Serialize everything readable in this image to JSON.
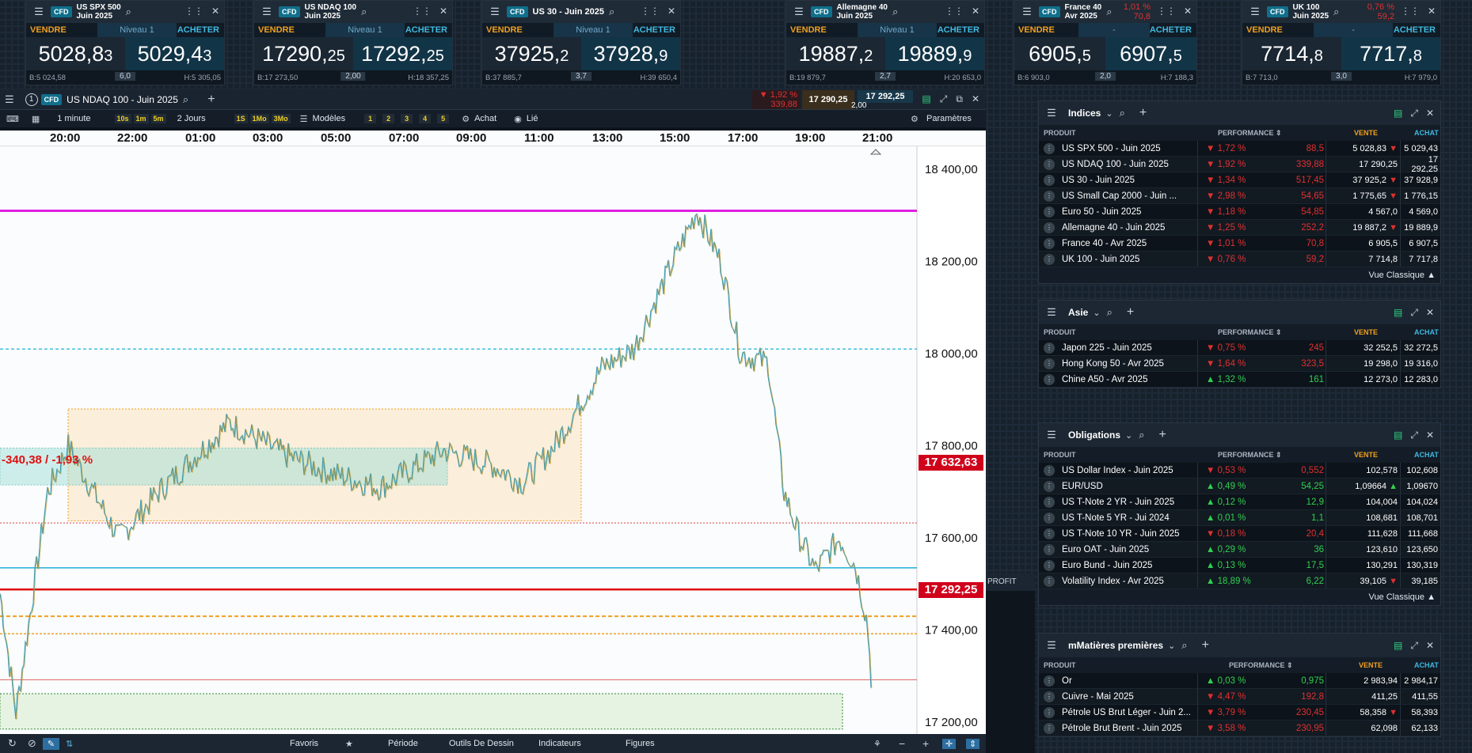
{
  "tiles": [
    {
      "name": "US SPX 500",
      "sub": "Juin 2025",
      "bid_main": "5028,8",
      "bid_small": "3",
      "ask_main": "5029,4",
      "ask_small": "3",
      "low": "B:5 024,58",
      "spread": "6,0",
      "high": "H:5 305,05",
      "level": "Niveau 1",
      "sell": "VENDRE",
      "buy": "ACHETER"
    },
    {
      "name": "US NDAQ 100",
      "sub": "Juin 2025",
      "bid_main": "17290,",
      "bid_small": "25",
      "ask_main": "17292,",
      "ask_small": "25",
      "low": "B:17 273,50",
      "spread": "2,00",
      "high": "H:18 357,25",
      "level": "Niveau 1",
      "sell": "VENDRE",
      "buy": "ACHETER"
    },
    {
      "name": "US 30 - Juin 2025",
      "sub": "",
      "bid_main": "37925,",
      "bid_small": "2",
      "ask_main": "37928,",
      "ask_small": "9",
      "low": "B:37 885,7",
      "spread": "3,7",
      "high": "H:39 650,4",
      "level": "Niveau 1",
      "sell": "VENDRE",
      "buy": "ACHETER"
    },
    {
      "name": "Allemagne 40",
      "sub": "Juin 2025",
      "bid_main": "19887,",
      "bid_small": "2",
      "ask_main": "19889,",
      "ask_small": "9",
      "low": "B:19 879,7",
      "spread": "2,7",
      "high": "H:20 653,0",
      "level": "Niveau 1",
      "sell": "VENDRE",
      "buy": "ACHETER"
    },
    {
      "name": "France 40",
      "sub": "Avr 2025",
      "pct": "1,01 %",
      "chg": "70,8",
      "bid_main": "6905,",
      "bid_small": "5",
      "ask_main": "6907,",
      "ask_small": "5",
      "low": "B:6 903,0",
      "spread": "2,0",
      "high": "H:7 188,3",
      "level": "-",
      "sell": "VENDRE",
      "buy": "ACHETER"
    },
    {
      "name": "UK 100",
      "sub": "Juin 2025",
      "pct": "0,76 %",
      "chg": "59,2",
      "bid_main": "7714,",
      "bid_small": "8",
      "ask_main": "7717,",
      "ask_small": "8",
      "low": "B:7 713,0",
      "spread": "3,0",
      "high": "H:7 979,0",
      "level": "-",
      "sell": "VENDRE",
      "buy": "ACHETER"
    }
  ],
  "chart": {
    "window_num": "1",
    "title": "US NDAQ 100 - Juin 2025",
    "pct": "1,92 %",
    "chg": "339,88",
    "bid": "17 290,25",
    "ask": "17 292,25",
    "spread": "2,00",
    "toolbar": {
      "interval": "1 minute",
      "i10s": "10s",
      "i1m": "1m",
      "i5m": "5m",
      "range": "2 Jours",
      "r1s": "1S",
      "r1mo": "1Mo",
      "r3mo": "3Mo",
      "models": "Modèles",
      "n1": "1",
      "n2": "2",
      "n3": "3",
      "n4": "4",
      "n5": "5",
      "buy": "Achat",
      "linked": "Lié",
      "settings": "Paramètres"
    },
    "x_ticks": [
      "20:00",
      "22:00",
      "01:00",
      "03:00",
      "05:00",
      "07:00",
      "09:00",
      "11:00",
      "13:00",
      "15:00",
      "17:00",
      "19:00",
      "21:00"
    ],
    "y_ticks": [
      "18 400,00",
      "18 200,00",
      "18 000,00",
      "17 800,00",
      "17 600,00",
      "17 400,00",
      "17 200,00"
    ],
    "tag_ref": "17 632,63",
    "tag_last": "17 292,25",
    "change_label": "-340,38 / -1,93 %",
    "profit_label": "PROFIT",
    "bottom": {
      "fav": "Favoris",
      "period": "Période",
      "draw": "Outils De Dessin",
      "ind": "Indicateurs",
      "fig": "Figures"
    }
  },
  "chart_data": {
    "type": "line",
    "title": "US NDAQ 100 - Juin 2025",
    "x": [
      "20:00",
      "22:00",
      "01:00",
      "03:00",
      "05:00",
      "07:00",
      "09:00",
      "11:00",
      "13:00",
      "15:00",
      "17:00",
      "19:00",
      "21:00"
    ],
    "y": [
      17400,
      17700,
      17770,
      17800,
      17790,
      17720,
      17790,
      17740,
      17950,
      18340,
      17970,
      17510,
      17292
    ],
    "ylim": [
      17140,
      18450
    ],
    "horizontal_lines": [
      18310,
      18010,
      17632.63,
      17535,
      17488,
      17430,
      17392,
      17292.25
    ]
  },
  "panels": [
    {
      "title": "Indices",
      "cols": [
        "PRODUIT",
        "PERFORMANCE",
        "VENTE",
        "ACHAT"
      ],
      "footer": "Vue Classique",
      "rows": [
        {
          "name": "US SPX 500 - Juin 2025",
          "pct": "1,72 %",
          "dir": "dn",
          "chg": "88,5",
          "bid": "5 028,83",
          "ask": "5 029,43",
          "arr": "▼"
        },
        {
          "name": "US NDAQ 100 - Juin 2025",
          "pct": "1,92 %",
          "dir": "dn",
          "chg": "339,88",
          "bid": "17 290,25",
          "ask": "17 292,25",
          "arr": ""
        },
        {
          "name": "US 30 - Juin 2025",
          "pct": "1,34 %",
          "dir": "dn",
          "chg": "517,45",
          "bid": "37 925,2",
          "ask": "37 928,9",
          "arr": "▼"
        },
        {
          "name": "US Small Cap 2000 - Juin ...",
          "pct": "2,98 %",
          "dir": "dn",
          "chg": "54,65",
          "bid": "1 775,65",
          "ask": "1 776,15",
          "arr": "▼"
        },
        {
          "name": "Euro 50 - Juin 2025",
          "pct": "1,18 %",
          "dir": "dn",
          "chg": "54,85",
          "bid": "4 567,0",
          "ask": "4 569,0",
          "arr": ""
        },
        {
          "name": "Allemagne 40 - Juin 2025",
          "pct": "1,25 %",
          "dir": "dn",
          "chg": "252,2",
          "bid": "19 887,2",
          "ask": "19 889,9",
          "arr": "▼"
        },
        {
          "name": "France 40 - Avr 2025",
          "pct": "1,01 %",
          "dir": "dn",
          "chg": "70,8",
          "bid": "6 905,5",
          "ask": "6 907,5",
          "arr": ""
        },
        {
          "name": "UK 100 - Juin 2025",
          "pct": "0,76 %",
          "dir": "dn",
          "chg": "59,2",
          "bid": "7 714,8",
          "ask": "7 717,8",
          "arr": ""
        }
      ]
    },
    {
      "title": "Asie",
      "cols": [
        "PRODUIT",
        "PERFORMANCE",
        "VENTE",
        "ACHAT"
      ],
      "footer": "",
      "rows": [
        {
          "name": "Japon 225 - Juin 2025",
          "pct": "0,75 %",
          "dir": "dn",
          "chg": "245",
          "bid": "32 252,5",
          "ask": "32 272,5",
          "arr": ""
        },
        {
          "name": "Hong Kong 50 - Avr 2025",
          "pct": "1,64 %",
          "dir": "dn",
          "chg": "323,5",
          "bid": "19 298,0",
          "ask": "19 316,0",
          "arr": ""
        },
        {
          "name": "Chine A50 - Avr 2025",
          "pct": "1,32 %",
          "dir": "up",
          "chg": "161",
          "bid": "12 273,0",
          "ask": "12 283,0",
          "arr": ""
        }
      ]
    },
    {
      "title": "Obligations",
      "cols": [
        "PRODUIT",
        "PERFORMANCE",
        "VENTE",
        "ACHAT"
      ],
      "footer": "Vue Classique",
      "rows": [
        {
          "name": "US Dollar Index - Juin 2025",
          "pct": "0,53 %",
          "dir": "dn",
          "chg": "0,552",
          "bid": "102,578",
          "ask": "102,608",
          "arr": ""
        },
        {
          "name": "EUR/USD",
          "pct": "0,49 %",
          "dir": "up",
          "chg": "54,25",
          "bid": "1,09664",
          "ask": "1,09670",
          "arr": "▲"
        },
        {
          "name": "US T-Note 2 YR - Juin 2025",
          "pct": "0,12 %",
          "dir": "up",
          "chg": "12,9",
          "bid": "104,004",
          "ask": "104,024",
          "arr": ""
        },
        {
          "name": "US T-Note 5 YR - Jui 2024",
          "pct": "0,01 %",
          "dir": "up",
          "chg": "1,1",
          "bid": "108,681",
          "ask": "108,701",
          "arr": ""
        },
        {
          "name": "US T-Note 10 YR - Juin 2025",
          "pct": "0,18 %",
          "dir": "dn",
          "chg": "20,4",
          "bid": "111,628",
          "ask": "111,668",
          "arr": ""
        },
        {
          "name": "Euro OAT - Juin 2025",
          "pct": "0,29 %",
          "dir": "up",
          "chg": "36",
          "bid": "123,610",
          "ask": "123,650",
          "arr": ""
        },
        {
          "name": "Euro Bund - Juin 2025",
          "pct": "0,13 %",
          "dir": "up",
          "chg": "17,5",
          "bid": "130,291",
          "ask": "130,319",
          "arr": ""
        },
        {
          "name": "Volatility Index - Avr 2025",
          "pct": "18,89 %",
          "dir": "up",
          "chg": "6,22",
          "bid": "39,105",
          "ask": "39,185",
          "arr": "▼"
        }
      ]
    },
    {
      "title": "mMatières premières",
      "cols": [
        "PRODUIT",
        "PERFORMANCE",
        "VENTE",
        "ACHAT"
      ],
      "footer": "",
      "rows": [
        {
          "name": "Or",
          "pct": "0,03 %",
          "dir": "up",
          "chg": "0,975",
          "bid": "2 983,94",
          "ask": "2 984,17",
          "arr": ""
        },
        {
          "name": "Cuivre - Mai 2025",
          "pct": "4,47 %",
          "dir": "dn",
          "chg": "192,8",
          "bid": "411,25",
          "ask": "411,55",
          "arr": ""
        },
        {
          "name": "Pétrole US Brut Léger - Juin 2...",
          "pct": "3,79 %",
          "dir": "dn",
          "chg": "230,45",
          "bid": "58,358",
          "ask": "58,393",
          "arr": "▼"
        },
        {
          "name": "Pétrole Brut Brent - Juin 2025",
          "pct": "3,58 %",
          "dir": "dn",
          "chg": "230,95",
          "bid": "62,098",
          "ask": "62,133",
          "arr": ""
        }
      ]
    }
  ],
  "colors": {
    "accent": "#0f6f8c",
    "down": "#e03030",
    "up": "#30d050",
    "sell": "#f0a020",
    "buy": "#3fb8e0",
    "magenta_line": "#e020e0",
    "red_line": "#e01010",
    "cyan_line": "#20b0d8",
    "orange_line": "#f0a020"
  }
}
